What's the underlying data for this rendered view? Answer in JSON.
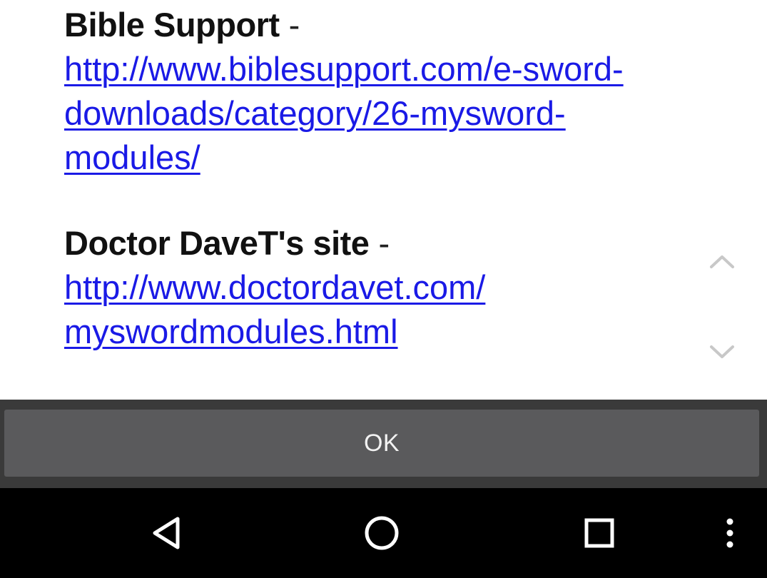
{
  "dialog": {
    "entries": [
      {
        "title": "Bible Support",
        "separator": " -",
        "link_lines": [
          "http://www.biblesupport.com/e-sword-",
          "downloads/category/26-mysword-",
          "modules/"
        ]
      },
      {
        "title": "Doctor DaveT's site",
        "separator": " -",
        "link_lines": [
          "http://www.doctordavet.com/",
          "myswordmodules.html"
        ]
      }
    ],
    "ok_label": "OK"
  },
  "icons": {
    "scroll_up": "chevron-up-icon",
    "scroll_down": "chevron-down-icon",
    "nav_back": "back-triangle-icon",
    "nav_home": "home-circle-icon",
    "nav_recents": "recents-square-icon",
    "nav_overflow": "overflow-dots-icon"
  },
  "colors": {
    "link": "#1a1ae6",
    "footer_bg": "#3a3a3a",
    "button_bg": "#5a5a5c",
    "navbar_bg": "#000000"
  }
}
